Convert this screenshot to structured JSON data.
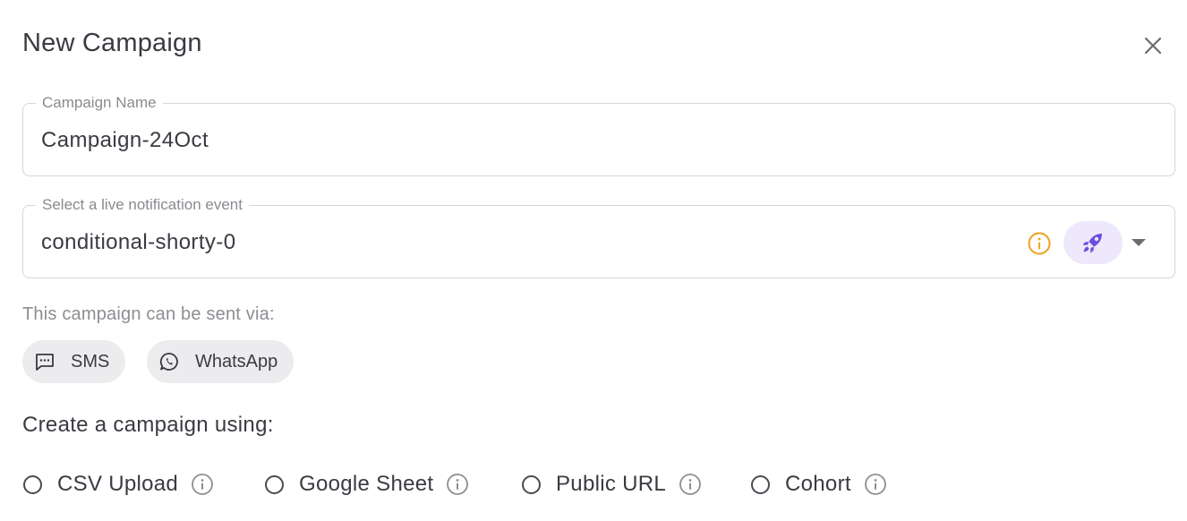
{
  "dialog": {
    "title": "New Campaign",
    "close_icon": "close-icon"
  },
  "campaign_name": {
    "label": "Campaign Name",
    "value": "Campaign-24Oct"
  },
  "event_select": {
    "label": "Select a live notification event",
    "value": "conditional-shorty-0",
    "info_icon": "info-icon",
    "action_icon": "rocket-icon",
    "dropdown_icon": "caret-down-icon"
  },
  "channels": {
    "heading": "This campaign can be sent via:",
    "items": [
      {
        "label": "SMS",
        "icon": "sms-icon"
      },
      {
        "label": "WhatsApp",
        "icon": "whatsapp-icon"
      }
    ]
  },
  "create_using": {
    "heading": "Create a campaign using:",
    "options": [
      {
        "label": "CSV Upload",
        "selected": false
      },
      {
        "label": "Google Sheet",
        "selected": false
      },
      {
        "label": "Public URL",
        "selected": false
      },
      {
        "label": "Cohort",
        "selected": false
      }
    ]
  },
  "colors": {
    "warning": "#f0a730",
    "accent": "#6c4de0",
    "accent_bg": "#ede8fb",
    "chip_bg": "#ececee"
  }
}
